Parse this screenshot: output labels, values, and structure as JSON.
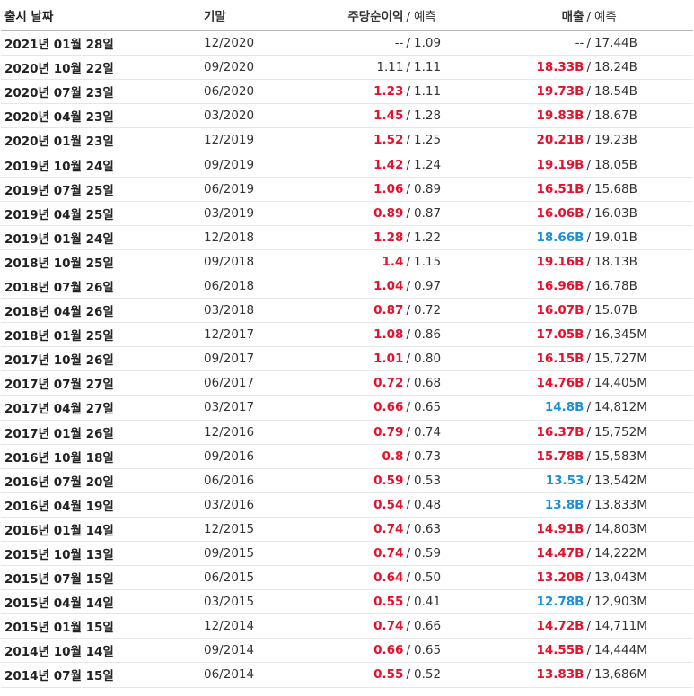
{
  "headers": {
    "date": "출시 날짜",
    "period": "기말",
    "eps_actual": "주당순이익",
    "eps_forecast": "예측",
    "rev_actual": "매출",
    "rev_forecast": "예측",
    "separator": "/"
  },
  "colors": {
    "beat": "#e8102b",
    "miss": "#1b8fd8",
    "text": "#333333"
  },
  "rows": [
    {
      "date": "2021년 01월 28일",
      "period": "12/2020",
      "eps": "--",
      "eps_status": "na",
      "eps_fc": "1.09",
      "rev": "--",
      "rev_status": "na",
      "rev_fc": "17.44B"
    },
    {
      "date": "2020년 10월 22일",
      "period": "09/2020",
      "eps": "1.11",
      "eps_status": "na",
      "eps_fc": "1.11",
      "rev": "18.33B",
      "rev_status": "up",
      "rev_fc": "18.24B"
    },
    {
      "date": "2020년 07월 23일",
      "period": "06/2020",
      "eps": "1.23",
      "eps_status": "up",
      "eps_fc": "1.11",
      "rev": "19.73B",
      "rev_status": "up",
      "rev_fc": "18.54B"
    },
    {
      "date": "2020년 04월 23일",
      "period": "03/2020",
      "eps": "1.45",
      "eps_status": "up",
      "eps_fc": "1.28",
      "rev": "19.83B",
      "rev_status": "up",
      "rev_fc": "18.67B"
    },
    {
      "date": "2020년 01월 23일",
      "period": "12/2019",
      "eps": "1.52",
      "eps_status": "up",
      "eps_fc": "1.25",
      "rev": "20.21B",
      "rev_status": "up",
      "rev_fc": "19.23B"
    },
    {
      "date": "2019년 10월 24일",
      "period": "09/2019",
      "eps": "1.42",
      "eps_status": "up",
      "eps_fc": "1.24",
      "rev": "19.19B",
      "rev_status": "up",
      "rev_fc": "18.05B"
    },
    {
      "date": "2019년 07월 25일",
      "period": "06/2019",
      "eps": "1.06",
      "eps_status": "up",
      "eps_fc": "0.89",
      "rev": "16.51B",
      "rev_status": "up",
      "rev_fc": "15.68B"
    },
    {
      "date": "2019년 04월 25일",
      "period": "03/2019",
      "eps": "0.89",
      "eps_status": "up",
      "eps_fc": "0.87",
      "rev": "16.06B",
      "rev_status": "up",
      "rev_fc": "16.03B"
    },
    {
      "date": "2019년 01월 24일",
      "period": "12/2018",
      "eps": "1.28",
      "eps_status": "up",
      "eps_fc": "1.22",
      "rev": "18.66B",
      "rev_status": "down",
      "rev_fc": "19.01B"
    },
    {
      "date": "2018년 10월 25일",
      "period": "09/2018",
      "eps": "1.4",
      "eps_status": "up",
      "eps_fc": "1.15",
      "rev": "19.16B",
      "rev_status": "up",
      "rev_fc": "18.13B"
    },
    {
      "date": "2018년 07월 26일",
      "period": "06/2018",
      "eps": "1.04",
      "eps_status": "up",
      "eps_fc": "0.97",
      "rev": "16.96B",
      "rev_status": "up",
      "rev_fc": "16.78B"
    },
    {
      "date": "2018년 04월 26일",
      "period": "03/2018",
      "eps": "0.87",
      "eps_status": "up",
      "eps_fc": "0.72",
      "rev": "16.07B",
      "rev_status": "up",
      "rev_fc": "15.07B"
    },
    {
      "date": "2018년 01월 25일",
      "period": "12/2017",
      "eps": "1.08",
      "eps_status": "up",
      "eps_fc": "0.86",
      "rev": "17.05B",
      "rev_status": "up",
      "rev_fc": "16,345M"
    },
    {
      "date": "2017년 10월 26일",
      "period": "09/2017",
      "eps": "1.01",
      "eps_status": "up",
      "eps_fc": "0.80",
      "rev": "16.15B",
      "rev_status": "up",
      "rev_fc": "15,727M"
    },
    {
      "date": "2017년 07월 27일",
      "period": "06/2017",
      "eps": "0.72",
      "eps_status": "up",
      "eps_fc": "0.68",
      "rev": "14.76B",
      "rev_status": "up",
      "rev_fc": "14,405M"
    },
    {
      "date": "2017년 04월 27일",
      "period": "03/2017",
      "eps": "0.66",
      "eps_status": "up",
      "eps_fc": "0.65",
      "rev": "14.8B",
      "rev_status": "down",
      "rev_fc": "14,812M"
    },
    {
      "date": "2017년 01월 26일",
      "period": "12/2016",
      "eps": "0.79",
      "eps_status": "up",
      "eps_fc": "0.74",
      "rev": "16.37B",
      "rev_status": "up",
      "rev_fc": "15,752M"
    },
    {
      "date": "2016년 10월 18일",
      "period": "09/2016",
      "eps": "0.8",
      "eps_status": "up",
      "eps_fc": "0.73",
      "rev": "15.78B",
      "rev_status": "up",
      "rev_fc": "15,583M"
    },
    {
      "date": "2016년 07월 20일",
      "period": "06/2016",
      "eps": "0.59",
      "eps_status": "up",
      "eps_fc": "0.53",
      "rev": "13.53",
      "rev_status": "down",
      "rev_fc": "13,542M"
    },
    {
      "date": "2016년 04월 19일",
      "period": "03/2016",
      "eps": "0.54",
      "eps_status": "up",
      "eps_fc": "0.48",
      "rev": "13.8B",
      "rev_status": "down",
      "rev_fc": "13,833M"
    },
    {
      "date": "2016년 01월 14일",
      "period": "12/2015",
      "eps": "0.74",
      "eps_status": "up",
      "eps_fc": "0.63",
      "rev": "14.91B",
      "rev_status": "up",
      "rev_fc": "14,803M"
    },
    {
      "date": "2015년 10월 13일",
      "period": "09/2015",
      "eps": "0.74",
      "eps_status": "up",
      "eps_fc": "0.59",
      "rev": "14.47B",
      "rev_status": "up",
      "rev_fc": "14,222M"
    },
    {
      "date": "2015년 07월 15일",
      "period": "06/2015",
      "eps": "0.64",
      "eps_status": "up",
      "eps_fc": "0.50",
      "rev": "13.20B",
      "rev_status": "up",
      "rev_fc": "13,043M"
    },
    {
      "date": "2015년 04월 14일",
      "period": "03/2015",
      "eps": "0.55",
      "eps_status": "up",
      "eps_fc": "0.41",
      "rev": "12.78B",
      "rev_status": "down",
      "rev_fc": "12,903M"
    },
    {
      "date": "2015년 01월 15일",
      "period": "12/2014",
      "eps": "0.74",
      "eps_status": "up",
      "eps_fc": "0.66",
      "rev": "14.72B",
      "rev_status": "up",
      "rev_fc": "14,711M"
    },
    {
      "date": "2014년 10월 14일",
      "period": "09/2014",
      "eps": "0.66",
      "eps_status": "up",
      "eps_fc": "0.65",
      "rev": "14.55B",
      "rev_status": "up",
      "rev_fc": "14,444M"
    },
    {
      "date": "2014년 07월 15일",
      "period": "06/2014",
      "eps": "0.55",
      "eps_status": "up",
      "eps_fc": "0.52",
      "rev": "13.83B",
      "rev_status": "up",
      "rev_fc": "13,686M"
    }
  ]
}
